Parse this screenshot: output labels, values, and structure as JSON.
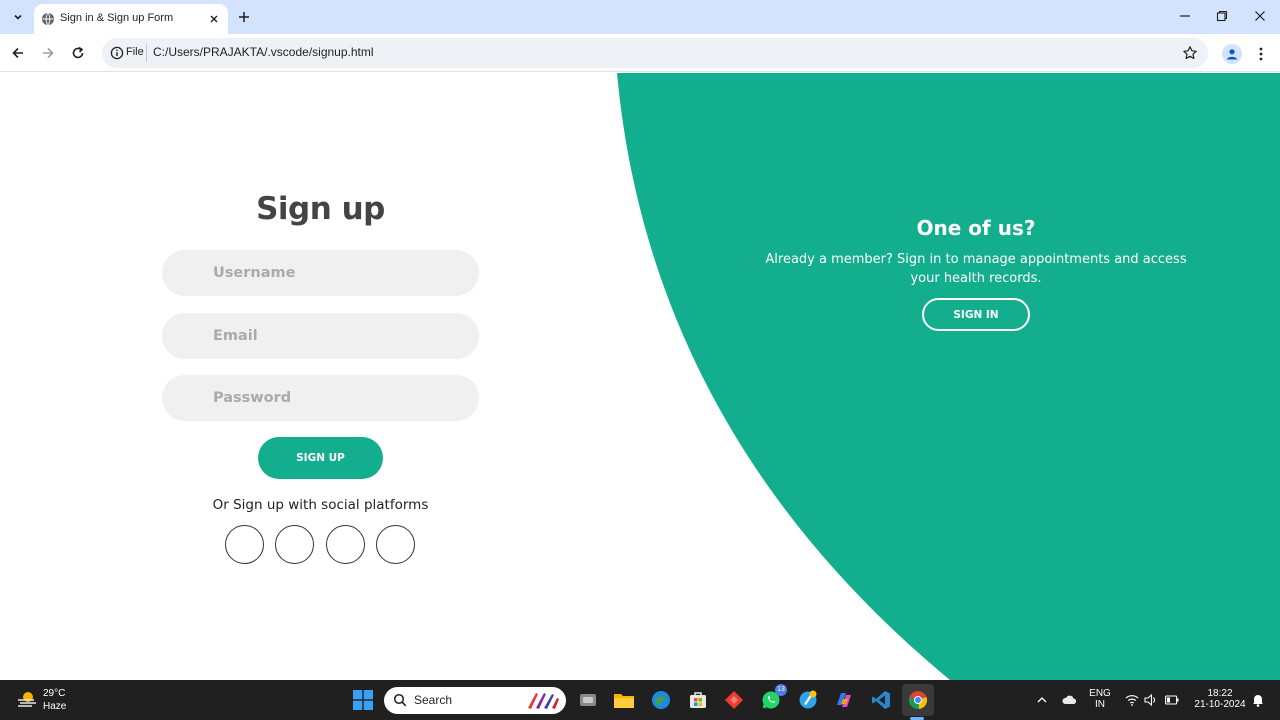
{
  "browser": {
    "tab_title": "Sign in & Sign up Form",
    "url_scheme": "File",
    "url": "C:/Users/PRAJAKTA/.vscode/signup.html"
  },
  "signup": {
    "title": "Sign up",
    "username_placeholder": "Username",
    "email_placeholder": "Email",
    "password_placeholder": "Password",
    "button": "SIGN UP",
    "social_text": "Or Sign up with social platforms",
    "social_buttons": [
      "social-1",
      "social-2",
      "social-3",
      "social-4"
    ]
  },
  "panel": {
    "title": "One of us?",
    "text": "Already a member? Sign in to manage appointments and access your health records.",
    "button": "SIGN IN"
  },
  "colors": {
    "accent": "#12ae8e",
    "field_bg": "#f0f0f0",
    "title": "#444444",
    "tab_bar": "#d3e3fd",
    "taskbar": "#202020"
  },
  "taskbar": {
    "temperature": "29°C",
    "condition": "Haze",
    "search_label": "Search",
    "whatsapp_badge": "13",
    "language": "ENG",
    "region": "IN",
    "time": "18:22",
    "date": "21-10-2024"
  }
}
